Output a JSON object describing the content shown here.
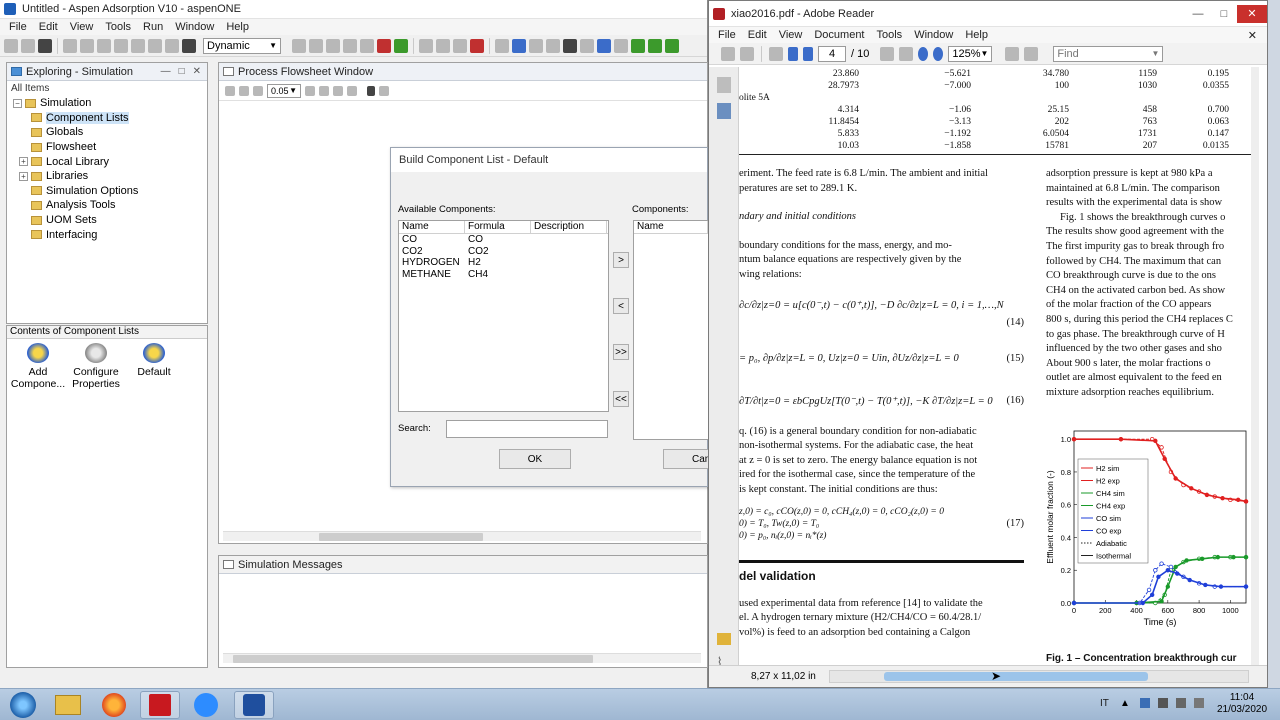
{
  "aspen": {
    "title": "Untitled - Aspen Adsorption V10 - aspenONE",
    "menu": [
      "File",
      "Edit",
      "View",
      "Tools",
      "Run",
      "Window",
      "Help"
    ],
    "run_mode": "Dynamic",
    "explorer": {
      "title": "Exploring - Simulation",
      "all_items": "All Items",
      "root": "Simulation",
      "items": [
        "Component Lists",
        "Globals",
        "Flowsheet",
        "Local Library",
        "Libraries",
        "Simulation Options",
        "Analysis Tools",
        "UOM Sets",
        "Interfacing"
      ]
    },
    "contents": {
      "title": "Contents of Component Lists",
      "items": [
        "Add Compone...",
        "Configure Properties",
        "Default"
      ]
    },
    "flowsheet": {
      "title": "Process Flowsheet Window",
      "zoom": "0.05"
    },
    "dialog": {
      "title": "Build Component List - Default",
      "available_label": "Available Components:",
      "components_label": "Components:",
      "col_name": "Name",
      "col_formula": "Formula",
      "col_description": "Description",
      "rows": [
        {
          "name": "CO",
          "formula": "CO"
        },
        {
          "name": "CO2",
          "formula": "CO2"
        },
        {
          "name": "HYDROGEN",
          "formula": "H2"
        },
        {
          "name": "METHANE",
          "formula": "CH4"
        }
      ],
      "btn_add": ">",
      "btn_remove": "<",
      "btn_add_all": ">>",
      "btn_remove_all": "<<",
      "search_label": "Search:",
      "ok": "OK",
      "cancel": "Can"
    },
    "messages_title": "Simulation Messages"
  },
  "adobe": {
    "title": "xiao2016.pdf - Adobe Reader",
    "menu": [
      "File",
      "Edit",
      "View",
      "Document",
      "Tools",
      "Window",
      "Help"
    ],
    "page": "4",
    "page_total": "/ 10",
    "zoom": "125%",
    "find": "Find",
    "page_size": "8,27 x 11,02 in",
    "table_rows": [
      [
        "23.860",
        "−5.621",
        "34.780",
        "1159",
        "0.195"
      ],
      [
        "28.7973",
        "−7.000",
        "100",
        "1030",
        "0.0355"
      ],
      [
        "4.314",
        "−1.06",
        "25.15",
        "458",
        "0.700"
      ],
      [
        "11.8454",
        "−3.13",
        "202",
        "763",
        "0.063"
      ],
      [
        "5.833",
        "−1.192",
        "6.0504",
        "1731",
        "0.147"
      ],
      [
        "10.03",
        "−1.858",
        "15781",
        "207",
        "0.0135"
      ]
    ],
    "table_label": "olite 5A",
    "left_col": [
      "eriment. The feed rate is 6.8 L/min. The ambient and initial",
      "peratures are set to 289.1 K.",
      "ndary and initial conditions",
      "boundary conditions for the mass, energy, and mo-",
      "ntum balance equations are respectively given by the",
      "wing relations:",
      "q. (16) is a general boundary condition for non-adiabatic",
      "non-isothermal systems. For the adiabatic case, the heat",
      "at z = 0 is set to zero. The energy balance equation is not",
      "ired for the isothermal case, since the temperature of the",
      "is kept constant. The initial conditions are thus:",
      "del validation",
      "used experimental data from reference [14] to validate the",
      "el. A hydrogen ternary mixture (H2/CH4/CO = 60.4/28.1/",
      "vol%) is feed to an adsorption bed containing a Calgon"
    ],
    "equations": [
      "(14)",
      "(15)",
      "(16)",
      "(17)"
    ],
    "right_col": [
      "adsorption pressure is kept at 980 kPa a",
      "maintained at 6.8 L/min. The comparison",
      "results with the experimental data is show",
      "Fig. 1 shows the breakthrough curves o",
      "The results show good agreement with the",
      "The first impurity gas to break through fro",
      "followed by CH4. The maximum that can",
      "CO breakthrough curve is due to the ons",
      "CH4 on the activated carbon bed. As show",
      "of the molar fraction of the CO appears",
      "800 s, during this period the CH4 replaces C",
      "to gas phase. The breakthrough curve of H",
      "influenced by the two other gases and sho",
      "About 900 s later, the molar fractions o",
      "outlet are almost equivalent to the feed en",
      "mixture adsorption reaches equilibrium."
    ],
    "fig_caption": "Fig. 1 – Concentration breakthrough cur"
  },
  "chart_data": {
    "type": "line",
    "xlabel": "Time (s)",
    "ylabel": "Effluent molar fraction (-)",
    "xlim": [
      0,
      1100
    ],
    "ylim": [
      0,
      1.05
    ],
    "x_ticks": [
      "0",
      "200",
      "400",
      "600",
      "800",
      "1000"
    ],
    "y_ticks": [
      "0.0",
      "0.2",
      "0.4",
      "0.6",
      "0.8",
      "1.0"
    ],
    "legend": [
      "H2 sim",
      "H2 exp",
      "CH4 sim",
      "CH4 exp",
      "CO sim",
      "CO exp",
      "Adiabatic",
      "Isothermal"
    ],
    "colors": {
      "H2": "#e02020",
      "CH4": "#1a9a2a",
      "CO": "#1f3fd8",
      "other": "#222222"
    },
    "series": [
      {
        "name": "H2 sim",
        "x": [
          0,
          300,
          500,
          560,
          620,
          700,
          800,
          900,
          1000,
          1100
        ],
        "y": [
          1.0,
          1.0,
          1.0,
          0.95,
          0.8,
          0.72,
          0.68,
          0.65,
          0.63,
          0.62
        ]
      },
      {
        "name": "H2 exp",
        "x": [
          0,
          300,
          520,
          580,
          650,
          750,
          850,
          950,
          1050,
          1100
        ],
        "y": [
          1.0,
          1.0,
          0.99,
          0.88,
          0.76,
          0.7,
          0.66,
          0.64,
          0.63,
          0.62
        ]
      },
      {
        "name": "CH4 sim",
        "x": [
          0,
          400,
          520,
          580,
          620,
          700,
          800,
          900,
          1000,
          1100
        ],
        "y": [
          0.0,
          0.0,
          0.0,
          0.05,
          0.2,
          0.25,
          0.27,
          0.28,
          0.28,
          0.28
        ]
      },
      {
        "name": "CH4 exp",
        "x": [
          0,
          400,
          560,
          600,
          650,
          720,
          820,
          920,
          1020,
          1100
        ],
        "y": [
          0.0,
          0.0,
          0.01,
          0.1,
          0.22,
          0.26,
          0.27,
          0.28,
          0.28,
          0.28
        ]
      },
      {
        "name": "CO sim",
        "x": [
          0,
          420,
          480,
          520,
          560,
          620,
          700,
          800,
          900,
          1100
        ],
        "y": [
          0.0,
          0.0,
          0.08,
          0.2,
          0.24,
          0.22,
          0.16,
          0.12,
          0.1,
          0.1
        ]
      },
      {
        "name": "CO exp",
        "x": [
          0,
          440,
          500,
          540,
          600,
          660,
          740,
          840,
          940,
          1100
        ],
        "y": [
          0.0,
          0.0,
          0.05,
          0.16,
          0.2,
          0.18,
          0.14,
          0.11,
          0.1,
          0.1
        ]
      }
    ]
  },
  "taskbar": {
    "lang": "IT",
    "time": "11:04",
    "date": "21/03/2020"
  }
}
